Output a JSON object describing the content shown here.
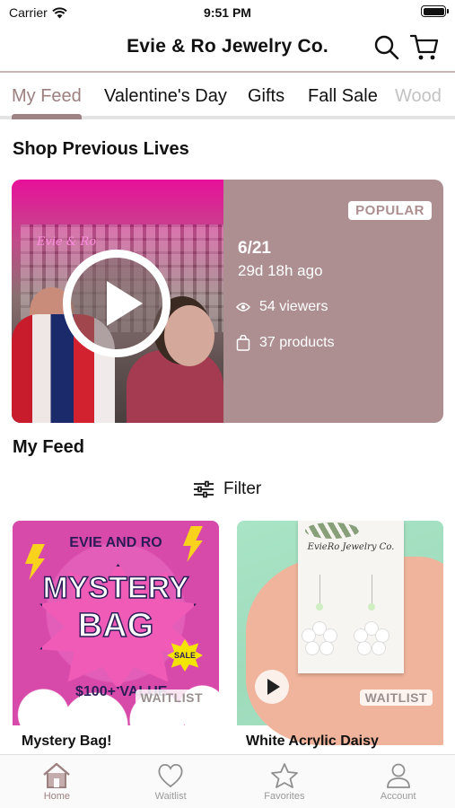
{
  "status_bar": {
    "carrier": "Carrier",
    "time": "9:51 PM"
  },
  "header": {
    "title": "Evie & Ro Jewelry Co."
  },
  "tabs": [
    {
      "label": "My Feed"
    },
    {
      "label": "Valentine's Day"
    },
    {
      "label": "Gifts"
    },
    {
      "label": "Fall Sale"
    },
    {
      "label": "Wood"
    }
  ],
  "previous_lives": {
    "title": "Shop Previous Lives",
    "card": {
      "badge": "POPULAR",
      "date": "6/21",
      "ago": "29d 18h ago",
      "viewers": "54 viewers",
      "products": "37 products"
    }
  },
  "feed": {
    "title": "My Feed",
    "filter_label": "Filter",
    "products": [
      {
        "name": "Mystery Bag!",
        "badge": "WAITLIST",
        "art": {
          "top": "EVIE AND RO",
          "line1": "MYSTERY",
          "line2": "BAG",
          "value": "$100+ VALUE",
          "sale": "SALE"
        }
      },
      {
        "name": "White Acrylic Daisy",
        "badge": "WAITLIST",
        "art": {
          "card_title": "EvieRo Jewelry Co."
        }
      }
    ]
  },
  "bottom_nav": [
    {
      "label": "Home",
      "icon": "home-icon",
      "active": true
    },
    {
      "label": "Waitlist",
      "icon": "heart-icon"
    },
    {
      "label": "Favorites",
      "icon": "star-icon"
    },
    {
      "label": "Account",
      "icon": "user-icon"
    }
  ],
  "colors": {
    "accent": "#9c7f7f",
    "live_card": "#ad8f91",
    "indicator": "#9f8384"
  }
}
